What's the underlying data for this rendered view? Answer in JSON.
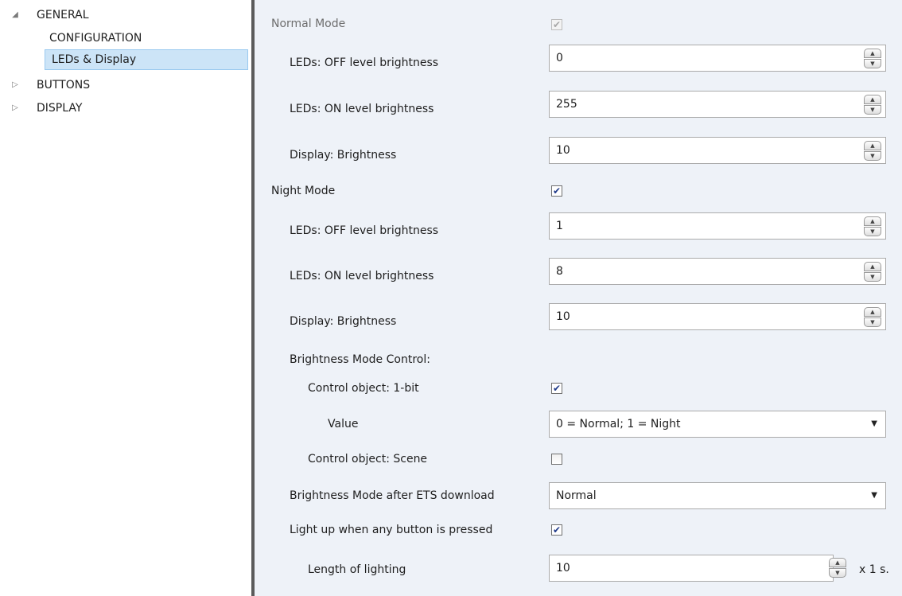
{
  "tree": {
    "items": [
      {
        "label": "GENERAL",
        "expanded": true,
        "has_arrow": true,
        "selected": false
      },
      {
        "label": "CONFIGURATION",
        "expanded": false,
        "has_arrow": false,
        "selected": false
      },
      {
        "label": "LEDs & Display",
        "expanded": false,
        "has_arrow": false,
        "selected": true
      },
      {
        "label": "BUTTONS",
        "expanded": false,
        "has_arrow": true,
        "selected": false
      },
      {
        "label": "DISPLAY",
        "expanded": false,
        "has_arrow": true,
        "selected": false
      }
    ],
    "arrow_expanded": "◢",
    "arrow_collapsed": "▷"
  },
  "params": {
    "normal_mode": {
      "label": "Normal Mode",
      "checked": true,
      "disabled": true
    },
    "normal_leds_off": {
      "label": "LEDs: OFF level brightness",
      "value": "0"
    },
    "normal_leds_on": {
      "label": "LEDs: ON level brightness",
      "value": "255"
    },
    "normal_display": {
      "label": "Display: Brightness",
      "value": "10"
    },
    "night_mode": {
      "label": "Night Mode",
      "checked": true
    },
    "night_leds_off": {
      "label": "LEDs: OFF level brightness",
      "value": "1"
    },
    "night_leds_on": {
      "label": "LEDs: ON level brightness",
      "value": "8"
    },
    "night_display": {
      "label": "Display: Brightness",
      "value": "10"
    },
    "brightness_mode_control": {
      "label": "Brightness Mode Control:"
    },
    "control_1bit": {
      "label": "Control object: 1-bit",
      "checked": true
    },
    "value": {
      "label": "Value",
      "selected": "0 = Normal; 1 = Night"
    },
    "control_scene": {
      "label": "Control object: Scene",
      "checked": false
    },
    "mode_after_download": {
      "label": "Brightness Mode after ETS download",
      "selected": "Normal"
    },
    "light_up": {
      "label": "Light up when any button is pressed",
      "checked": true
    },
    "length_lighting": {
      "label": "Length of lighting",
      "value": "10",
      "unit": "x 1 s."
    }
  },
  "glyphs": {
    "check": "✔",
    "spin_up": "▲",
    "spin_down": "▼",
    "drop_arrow": "▼"
  },
  "colors": {
    "selection_bg": "#cce4f7",
    "panel_bg": "#eef2f8",
    "splitter": "#5b5b5b",
    "check": "#1f3a8a"
  }
}
